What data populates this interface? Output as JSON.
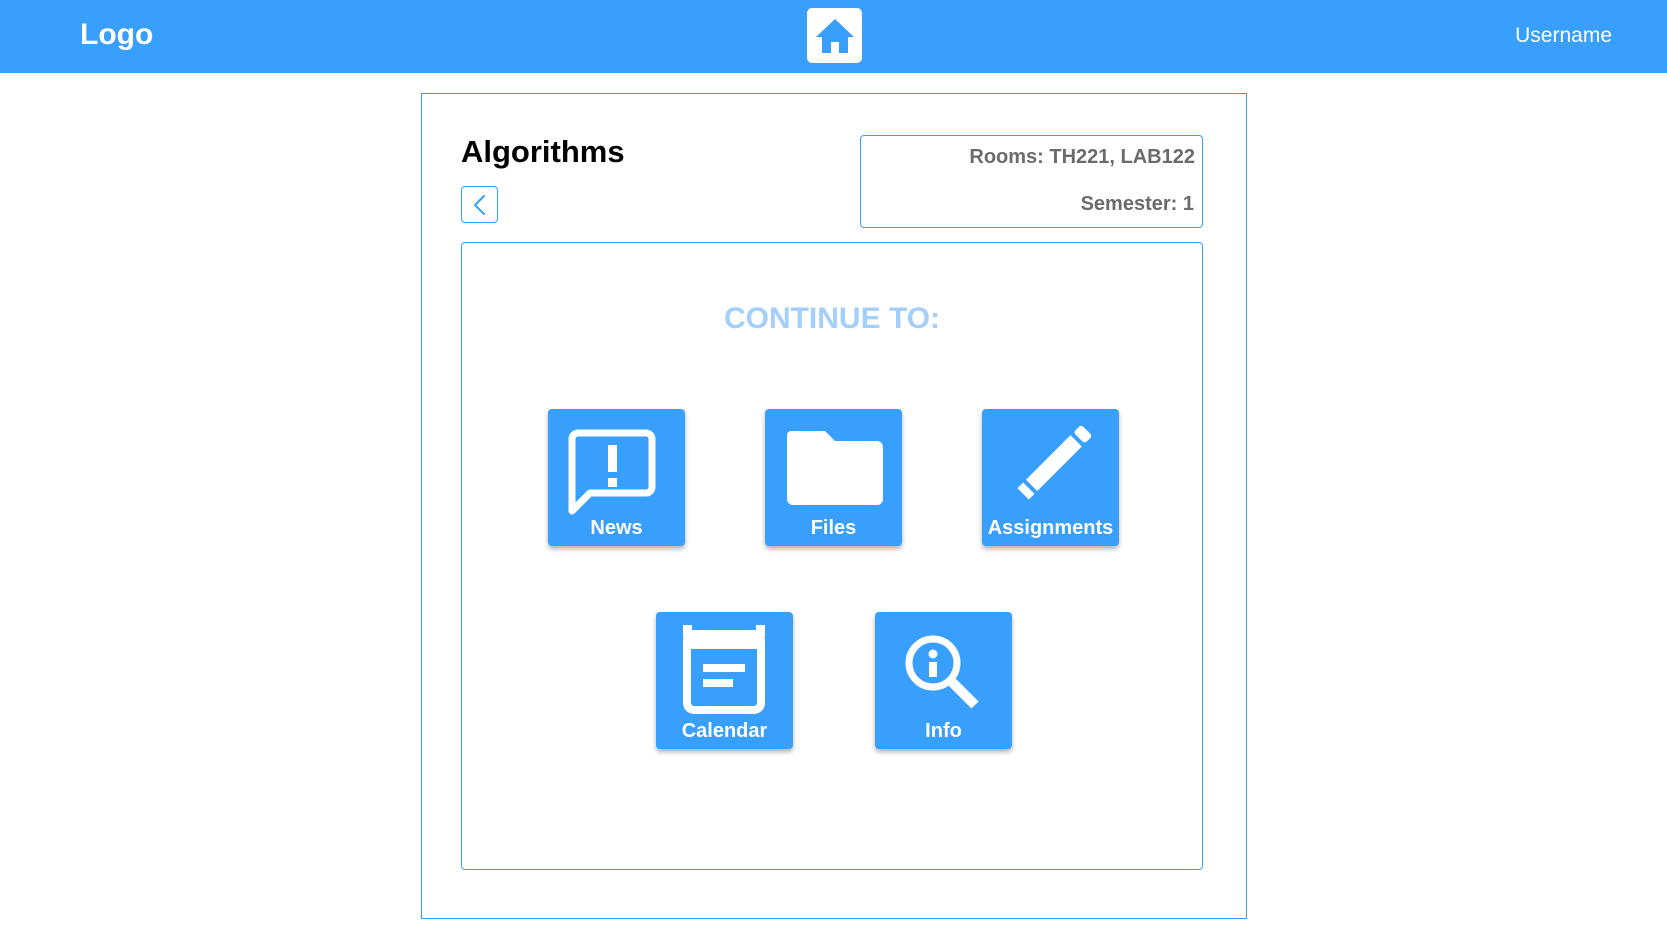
{
  "header": {
    "logo": "Logo",
    "home_icon": "home-icon",
    "username": "Username"
  },
  "course": {
    "title": "Algorithms",
    "back_icon": "chevron-left-icon",
    "rooms": "Rooms: TH221, LAB122",
    "semester": "Semester: 1"
  },
  "panel": {
    "heading": "CONTINUE TO:",
    "tiles": [
      {
        "label": "News",
        "icon": "news-alert-icon"
      },
      {
        "label": "Files",
        "icon": "folder-icon"
      },
      {
        "label": "Assignments",
        "icon": "pencil-icon"
      },
      {
        "label": "Calendar",
        "icon": "calendar-icon"
      },
      {
        "label": "Info",
        "icon": "info-search-icon"
      }
    ]
  },
  "colors": {
    "primary": "#399ffd",
    "heading_light": "#a3d0fa",
    "meta_text": "#6b6b6b"
  }
}
